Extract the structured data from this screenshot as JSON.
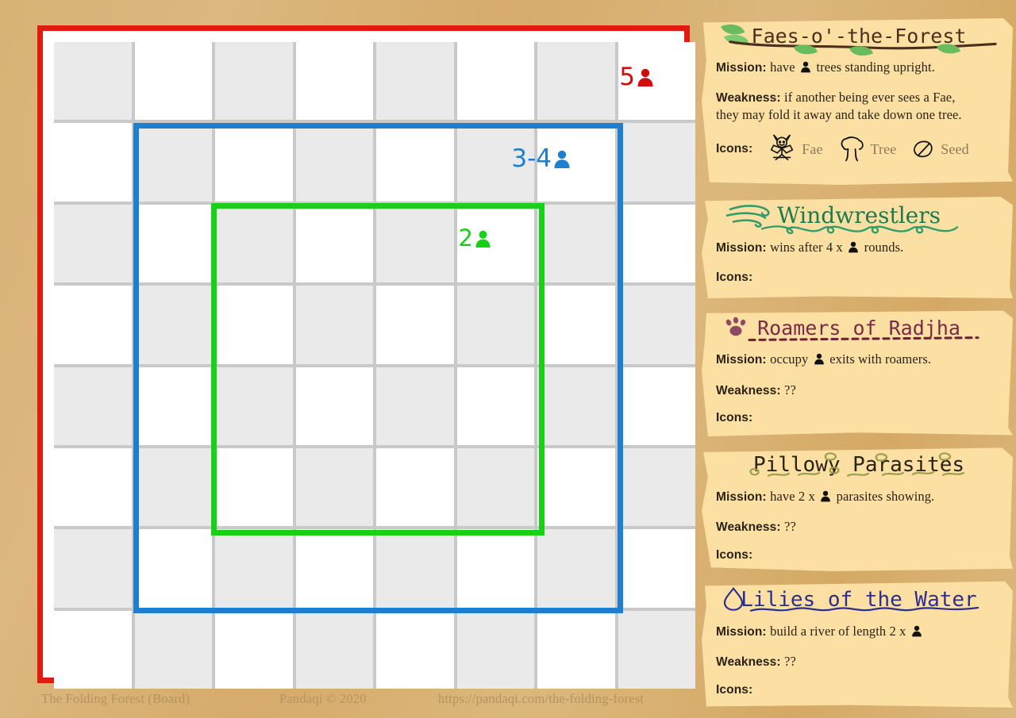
{
  "board": {
    "name": "The Folding Forest board",
    "grid_size": 8,
    "zones": [
      {
        "id": "red",
        "label": "5",
        "color": "#d00c0c",
        "icon": "person-icon",
        "players": "5",
        "span_cols": 8,
        "span_rows": 8
      },
      {
        "id": "blue",
        "label": "3-4",
        "color": "#1e7fd1",
        "icon": "person-icon",
        "players": "3-4",
        "span_cols": 6,
        "span_rows": 6
      },
      {
        "id": "green",
        "label": "2",
        "color": "#17d017",
        "icon": "person-icon",
        "players": "2",
        "span_cols": 4,
        "span_rows": 4
      }
    ],
    "cell_light": "#ffffff",
    "cell_dark": "#eaeaea",
    "grid_line": "#c9c9c9"
  },
  "footer": {
    "title": "The Folding Forest (Board)",
    "credit": "Pandaqi © 2020",
    "url": "https://pandaqi.com/the-folding-forest"
  },
  "cards": [
    {
      "title": "Faes-o'-the-Forest",
      "title_color": "#4a2f1b",
      "deco": "branch-with-leaves",
      "deco_color": "#6aba5e",
      "mission_label": "Mission:",
      "mission_text_before": "have",
      "mission_text_after": "trees standing upright.",
      "weakness_label": "Weakness:",
      "weakness_text": "if another being ever sees a Fae,",
      "weakness_text2": "they may fold it away and take down one tree.",
      "icons_label": "Icons:",
      "icons": [
        {
          "name": "fae-icon",
          "label": "Fae"
        },
        {
          "name": "tree-icon",
          "label": "Tree"
        },
        {
          "name": "seed-icon",
          "label": "Seed"
        }
      ]
    },
    {
      "title": "Windwrestlers",
      "title_color": "#1f7a4e",
      "deco": "wind-swirls",
      "deco_color": "#2f9e69",
      "mission_label": "Mission:",
      "mission_text_before": "wins after 4 x",
      "mission_text_after": "rounds.",
      "icons_label": "Icons:",
      "icons": []
    },
    {
      "title": "Roamers of Radjha",
      "title_color": "#7a2b43",
      "deco": "paw-dashed-underline",
      "deco_color": "#8e4a63",
      "mission_label": "Mission:",
      "mission_text_before": "occupy",
      "mission_text_after": "exits with roamers.",
      "weakness_label": "Weakness:",
      "weakness_text": "??",
      "icons_label": "Icons:",
      "icons": []
    },
    {
      "title": "Pillowy Parasites",
      "title_color": "#2b2216",
      "deco": "worm-squiggles",
      "deco_color": "#9aa04a",
      "mission_label": "Mission:",
      "mission_text_before": "have 2 x",
      "mission_text_after": "parasites showing.",
      "weakness_label": "Weakness:",
      "weakness_text": "??",
      "icons_label": "Icons:",
      "icons": []
    },
    {
      "title": "Lilies of the Water",
      "title_color": "#2d2f8e",
      "deco": "droplet-wave-underline",
      "deco_color": "#3a3cc0",
      "mission_label": "Mission:",
      "mission_text_before": "build a river of length 2 x",
      "mission_text_after": "",
      "weakness_label": "Weakness:",
      "weakness_text": "??",
      "icons_label": "Icons:",
      "icons": []
    }
  ]
}
